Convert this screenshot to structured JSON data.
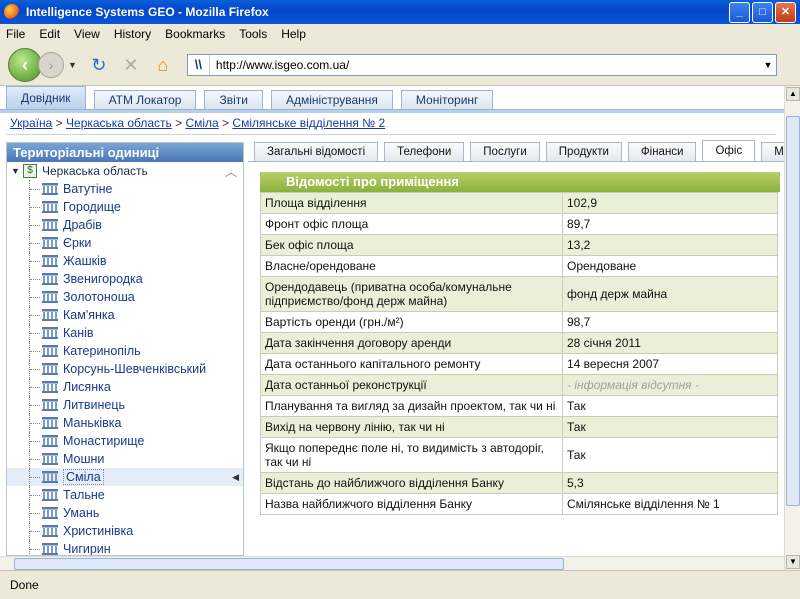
{
  "window": {
    "title": "Intelligence Systems GEO - Mozilla Firefox"
  },
  "menu": [
    "File",
    "Edit",
    "View",
    "History",
    "Bookmarks",
    "Tools",
    "Help"
  ],
  "url": "http://www.isgeo.com.ua/",
  "top_tabs": [
    {
      "label": "Довідник",
      "active": true
    },
    {
      "label": "АТМ Локатор",
      "active": false
    },
    {
      "label": "Звіти",
      "active": false
    },
    {
      "label": "Адміністрування",
      "active": false
    },
    {
      "label": "Моніторинг",
      "active": false
    }
  ],
  "breadcrumb": [
    "Україна",
    "Черкаська область",
    "Сміла",
    "Смілянське відділення № 2"
  ],
  "breadcrumb_sep": " > ",
  "sidebar": {
    "title": "Територіальні одиниці",
    "root": "Черкаська область",
    "root_icon_text": "$",
    "items": [
      "Ватутіне",
      "Городище",
      "Драбів",
      "Єрки",
      "Жашків",
      "Звенигородка",
      "Золотоноша",
      "Кам'янка",
      "Канів",
      "Катеринопіль",
      "Корсунь-Шевченківський",
      "Лисянка",
      "Литвинець",
      "Маньківка",
      "Монастирище",
      "Мошни",
      "Сміла",
      "Тальне",
      "Умань",
      "Христинівка",
      "Чигирин"
    ],
    "selected": "Сміла"
  },
  "inner_tabs": [
    {
      "label": "Загальні відомості",
      "active": false
    },
    {
      "label": "Телефони",
      "active": false
    },
    {
      "label": "Послуги",
      "active": false
    },
    {
      "label": "Продукти",
      "active": false
    },
    {
      "label": "Фінанси",
      "active": false
    },
    {
      "label": "Офіс",
      "active": true
    },
    {
      "label": "Матеріа",
      "active": false
    }
  ],
  "panel": {
    "title": "Відомості про приміщення",
    "rows": [
      {
        "k": "Площа відділення",
        "v": "102,9"
      },
      {
        "k": "Фронт офіс площа",
        "v": "89,7"
      },
      {
        "k": "Бек офіс площа",
        "v": "13,2"
      },
      {
        "k": "Власне/орендоване",
        "v": "Орендоване"
      },
      {
        "k": "Орендодавець (приватна особа/комунальне підприємство/фонд держ майна)",
        "v": "фонд держ майна"
      },
      {
        "k": "Вартість оренди (грн./м²)",
        "v": "98,7"
      },
      {
        "k": "Дата закінчення договору аренди",
        "v": "28 січня 2011"
      },
      {
        "k": "Дата останнього капітального ремонту",
        "v": "14 вересня 2007"
      },
      {
        "k": "Дата останньої реконструкції",
        "v": "- інформація відсутня -",
        "na": true
      },
      {
        "k": "Планування та вигляд за дизайн проектом, так чи ні",
        "v": "Так"
      },
      {
        "k": "Вихід на червону лінію, так чи ні",
        "v": "Так"
      },
      {
        "k": "Якщо попереднє поле ні, то видимість з автодоріг, так чи ні",
        "v": "Так"
      },
      {
        "k": "Відстань до найближчого відділення Банку",
        "v": "5,3"
      },
      {
        "k": "Назва найближчого відділення Банку",
        "v": "Смілянське відділення № 1"
      }
    ]
  },
  "status": "Done",
  "colors": {
    "accent": "#8cb03a",
    "titlebar": "#0346c8",
    "link": "#1a3aa0"
  }
}
